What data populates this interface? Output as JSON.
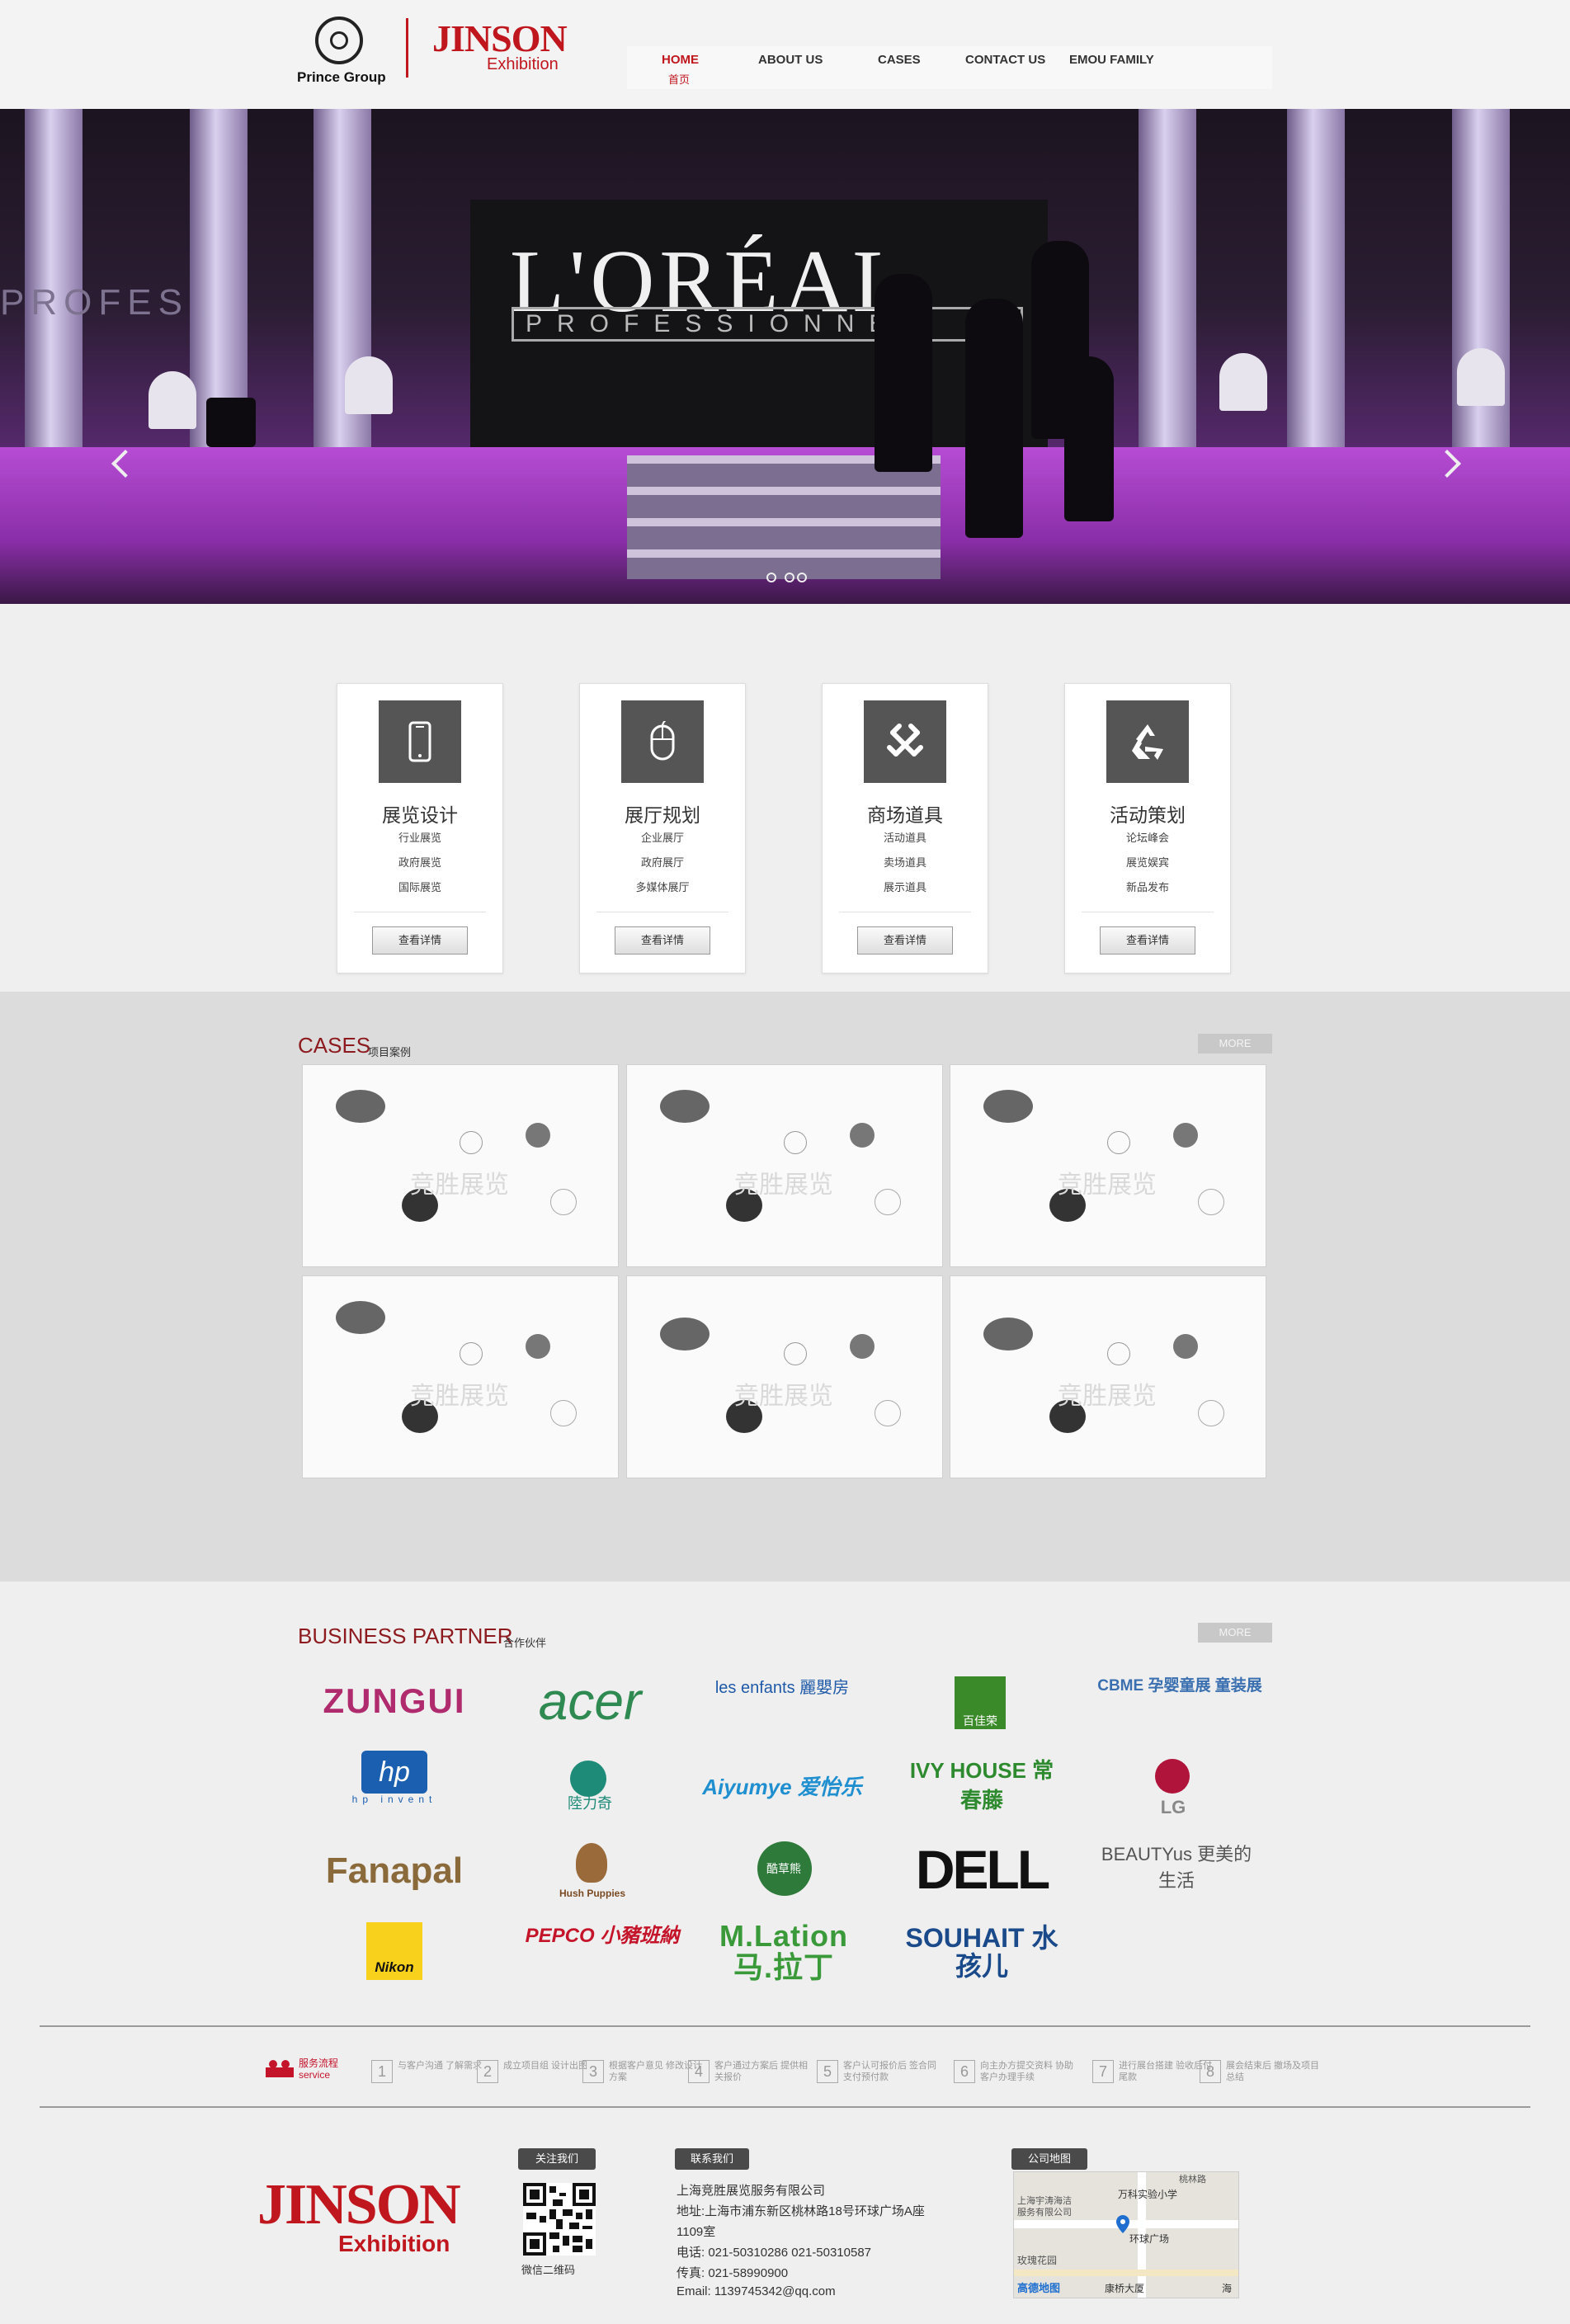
{
  "header": {
    "prince_logo_text": "Prince Group",
    "jinson_big": "JINSON",
    "jinson_small": "Exhibition",
    "nav": [
      {
        "label": "HOME",
        "sub": "首页"
      },
      {
        "label": "ABOUT US"
      },
      {
        "label": "CASES"
      },
      {
        "label": "CONTACT US"
      },
      {
        "label": "EMOU FAMILY"
      }
    ]
  },
  "banner": {
    "screen_text": "L'ORÉAL",
    "screen_sub": "PROFESSIONNEL",
    "left_wall_text": "PROFES",
    "slides": 3
  },
  "services": [
    {
      "title": "展览设计",
      "items": [
        "行业展览",
        "政府展览",
        "国际展览"
      ],
      "button": "查看详情",
      "icon": "smartphone-icon"
    },
    {
      "title": "展厅规划",
      "items": [
        "企业展厅",
        "政府展厅",
        "多媒体展厅"
      ],
      "button": "查看详情",
      "icon": "mouse-icon"
    },
    {
      "title": "商场道具",
      "items": [
        "活动道具",
        "卖场道具",
        "展示道具"
      ],
      "button": "查看详情",
      "icon": "joomla-icon"
    },
    {
      "title": "活动策划",
      "items": [
        "论坛峰会",
        "展览娱宾",
        "新品发布"
      ],
      "button": "查看详情",
      "icon": "recycle-icon"
    }
  ],
  "cases": {
    "title": "CASES",
    "subtitle": "项目案例",
    "more": "MORE",
    "watermark": "竞胜展览"
  },
  "partners": {
    "title": "BUSINESS PARTNER",
    "subtitle": "合作伙伴",
    "more": "MORE",
    "logos": [
      {
        "text": "ZUNGUI",
        "color": "#b02a6e"
      },
      {
        "text": "acer",
        "color": "#2e8a50"
      },
      {
        "text": "les enfants 麗嬰房",
        "color": "#1f5aa8"
      },
      {
        "text": "百佳荣",
        "color": "#3a8a2a"
      },
      {
        "text": "CBME 孕婴童展 童装展",
        "color": "#3a6fb0"
      },
      {
        "text": "hp invent",
        "color": "#1a5fb0"
      },
      {
        "text": "陸力奇",
        "color": "#1e8a78"
      },
      {
        "text": "Aiyumye 爱怡乐",
        "color": "#1f8fd0"
      },
      {
        "text": "IVY HOUSE 常春藤",
        "color": "#2e8a2e"
      },
      {
        "text": "LG",
        "color": "#b0143a"
      },
      {
        "text": "Fanapal",
        "color": "#8a6a3a"
      },
      {
        "text": "Hush Puppies",
        "color": "#7a4a22"
      },
      {
        "text": "酷草熊",
        "color": "#2e7a3a"
      },
      {
        "text": "DELL",
        "color": "#111111"
      },
      {
        "text": "BEAUTYus 更美的生活",
        "color": "#555555"
      },
      {
        "text": "Nikon",
        "color": "#222222"
      },
      {
        "text": "PEPCO 小豬班納",
        "color": "#c4142a"
      },
      {
        "text": "M.Lation 马.拉丁",
        "color": "#3a9a3a"
      },
      {
        "text": "SOUHAIT 水孩儿",
        "color": "#1a4a8a"
      }
    ]
  },
  "process": {
    "label_cn": "服务流程",
    "label_en": "service",
    "steps": [
      {
        "n": "1",
        "text": "与客户沟通 了解需求"
      },
      {
        "n": "2",
        "text": "成立项目组 设计出图"
      },
      {
        "n": "3",
        "text": "根据客户意见 修改设计方案"
      },
      {
        "n": "4",
        "text": "客户通过方案后 提供相关报价"
      },
      {
        "n": "5",
        "text": "客户认可报价后 签合同支付预付款"
      },
      {
        "n": "6",
        "text": "向主办方提交资料 协助客户办理手续"
      },
      {
        "n": "7",
        "text": "进行展台搭建 验收后付尾款"
      },
      {
        "n": "8",
        "text": "展会结束后 撤场及项目总结"
      }
    ]
  },
  "footer": {
    "jinson_big": "JINSON",
    "jinson_small": "Exhibition",
    "qr_tag": "关注我们",
    "qr_caption": "微信二维码",
    "contact_tag": "联系我们",
    "company": "上海竞胜展览服务有限公司",
    "address1": "地址:上海市浦东新区桃林路18号环球广场A座",
    "address2": "1109室",
    "phone": "电话: 021-50310286 021-50310587",
    "fax": "传真: 021-58990900",
    "email": "Email: 1139745342@qq.com",
    "map_tag": "公司地图",
    "map_labels": [
      "万科实验小学",
      "上海宇涛海洁",
      "服务有限公司",
      "环球广场",
      "玫瑰花园",
      "高德地图",
      "康桥大厦",
      "桃林路",
      "海"
    ]
  }
}
